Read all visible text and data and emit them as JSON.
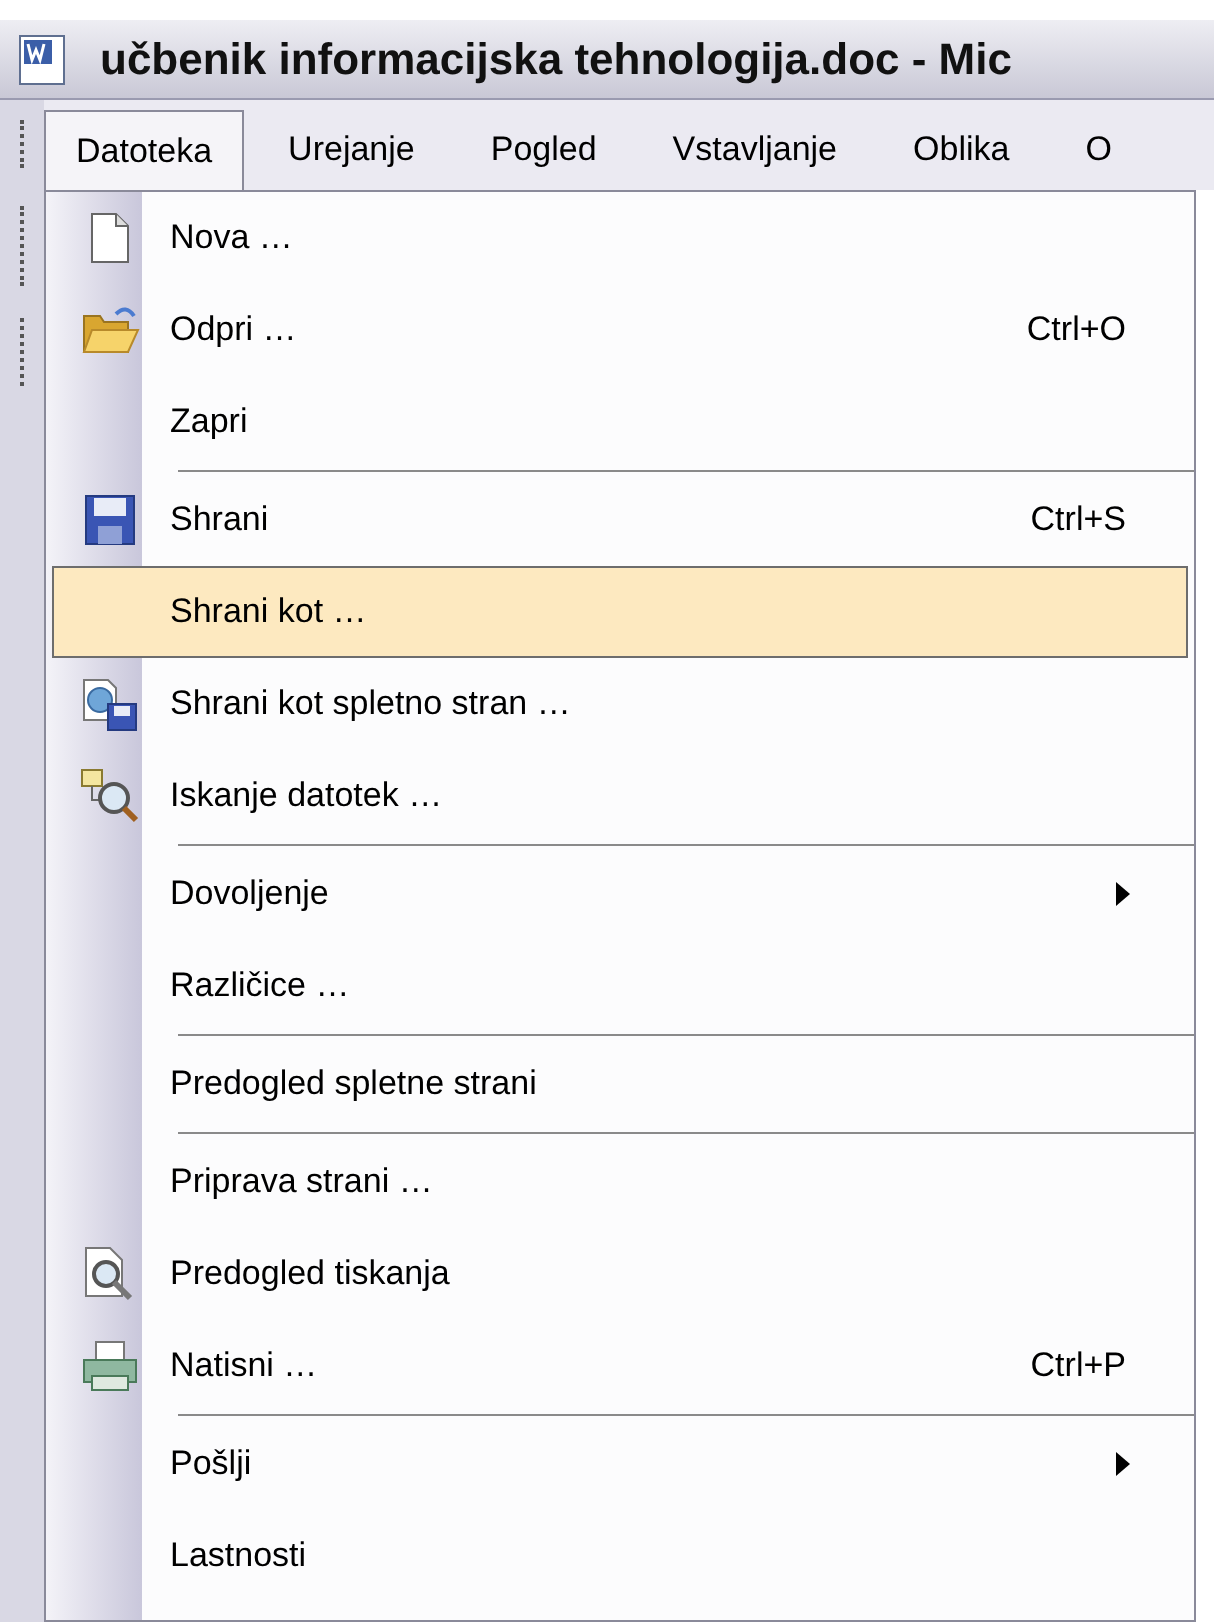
{
  "window": {
    "title": "učbenik informacijska tehnologija.doc - Mic"
  },
  "menubar": [
    {
      "label": "Datoteka",
      "selected": true
    },
    {
      "label": "Urejanje",
      "selected": false
    },
    {
      "label": "Pogled",
      "selected": false
    },
    {
      "label": "Vstavljanje",
      "selected": false
    },
    {
      "label": "Oblika",
      "selected": false
    },
    {
      "label": "O",
      "selected": false
    }
  ],
  "menu": [
    {
      "kind": "item",
      "label": "Nova …",
      "selected": false
    },
    {
      "kind": "item",
      "label": "Odpri …",
      "shortcut": "Ctrl+O",
      "selected": false
    },
    {
      "kind": "item",
      "label": "Zapri",
      "selected": false
    },
    {
      "kind": "separator"
    },
    {
      "kind": "item",
      "label": "Shrani",
      "shortcut": "Ctrl+S",
      "selected": false
    },
    {
      "kind": "item",
      "label": "Shrani kot …",
      "selected": true
    },
    {
      "kind": "item",
      "label": "Shrani kot spletno stran …",
      "selected": false
    },
    {
      "kind": "item",
      "label": "Iskanje datotek …",
      "selected": false
    },
    {
      "kind": "separator"
    },
    {
      "kind": "item",
      "label": "Dovoljenje",
      "submenu": true,
      "selected": false
    },
    {
      "kind": "item",
      "label": "Različice …",
      "selected": false
    },
    {
      "kind": "separator"
    },
    {
      "kind": "item",
      "label": "Predogled spletne strani",
      "selected": false
    },
    {
      "kind": "separator"
    },
    {
      "kind": "item",
      "label": "Priprava strani …",
      "selected": false
    },
    {
      "kind": "item",
      "label": "Predogled tiskanja",
      "selected": false
    },
    {
      "kind": "item",
      "label": "Natisni …",
      "shortcut": "Ctrl+P",
      "selected": false
    },
    {
      "kind": "separator"
    },
    {
      "kind": "item",
      "label": "Pošlji",
      "submenu": true,
      "selected": false
    },
    {
      "kind": "item",
      "label": "Lastnosti",
      "selected": false
    }
  ]
}
